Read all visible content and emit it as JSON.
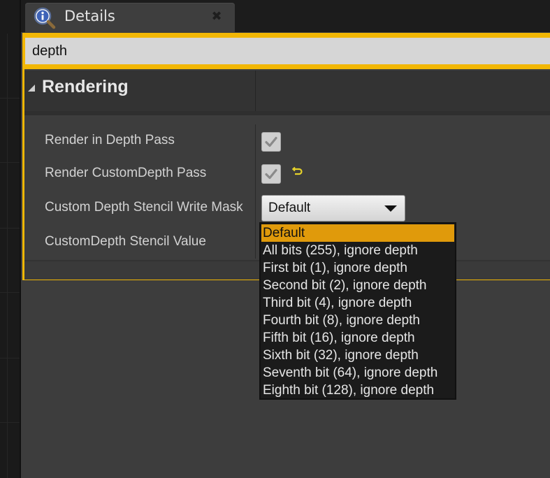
{
  "tab": {
    "title": "Details",
    "icon": "info-magnifier-icon",
    "close_icon": "close-icon"
  },
  "search": {
    "value": "depth",
    "placeholder": ""
  },
  "category": {
    "label": "Rendering",
    "icon": "collapse-triangle-icon"
  },
  "properties": [
    {
      "label": "Render in Depth Pass",
      "control": "checkbox",
      "checked": true
    },
    {
      "label": "Render CustomDepth Pass",
      "control": "checkbox",
      "checked": true,
      "reset_icon": "reset-to-default-icon"
    },
    {
      "label": "Custom Depth Stencil Write Mask",
      "control": "dropdown",
      "value": "Default"
    },
    {
      "label": "CustomDepth Stencil Value",
      "control": "number"
    }
  ],
  "dropdown": {
    "selected_index": 0,
    "options": [
      "Default",
      "All bits (255), ignore depth",
      "First bit (1), ignore depth",
      "Second bit (2), ignore depth",
      "Third bit (4), ignore depth",
      "Fourth bit (8), ignore depth",
      "Fifth bit (16), ignore depth",
      "Sixth bit (32), ignore depth",
      "Seventh bit (64), ignore depth",
      "Eighth bit (128), ignore depth"
    ]
  },
  "colors": {
    "accent": "#f2b705",
    "selected_item": "#e09a0b",
    "panel": "#3d3d3d",
    "reset_icon": "#e6d22a"
  }
}
